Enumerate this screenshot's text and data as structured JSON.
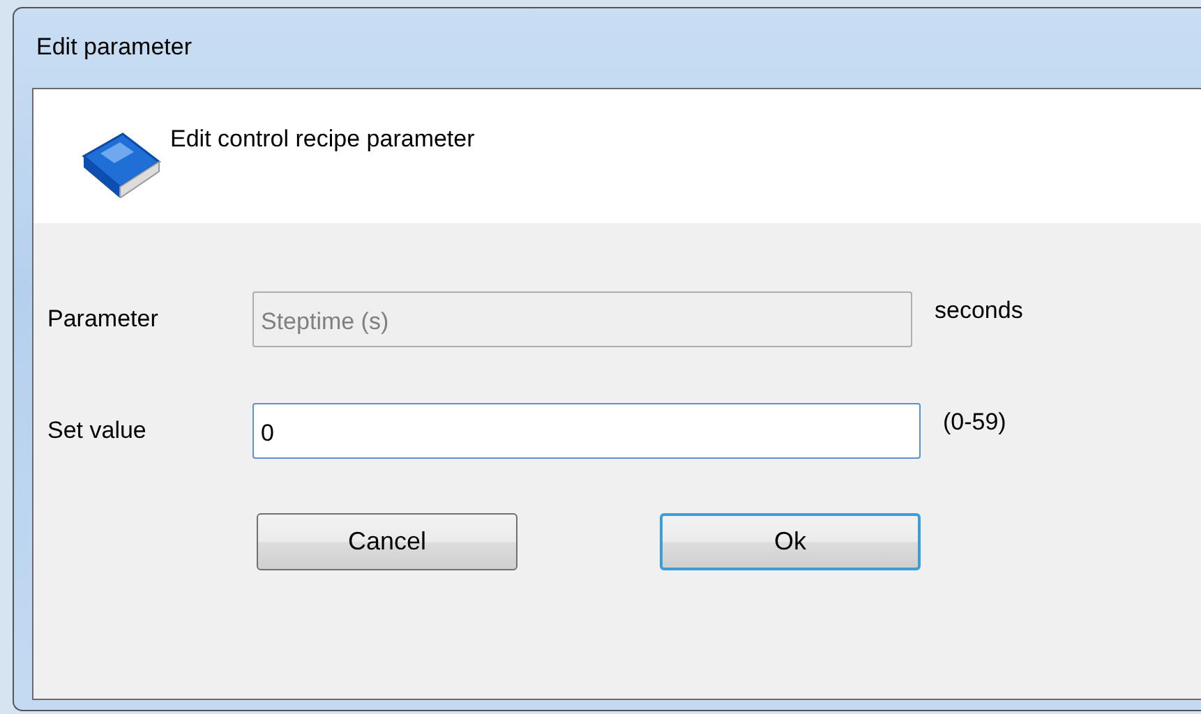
{
  "window": {
    "title": "Edit parameter"
  },
  "header": {
    "text": "Edit control recipe parameter"
  },
  "fields": [
    {
      "label": "Parameter",
      "value": "Steptime (s)",
      "unit": "seconds",
      "disabled": true,
      "focused": false
    },
    {
      "label": "Set value",
      "value": "0",
      "unit": "(0-59)",
      "disabled": false,
      "focused": true
    }
  ],
  "buttons": [
    {
      "label": "Cancel",
      "default": false
    },
    {
      "label": "Ok",
      "default": true
    }
  ]
}
